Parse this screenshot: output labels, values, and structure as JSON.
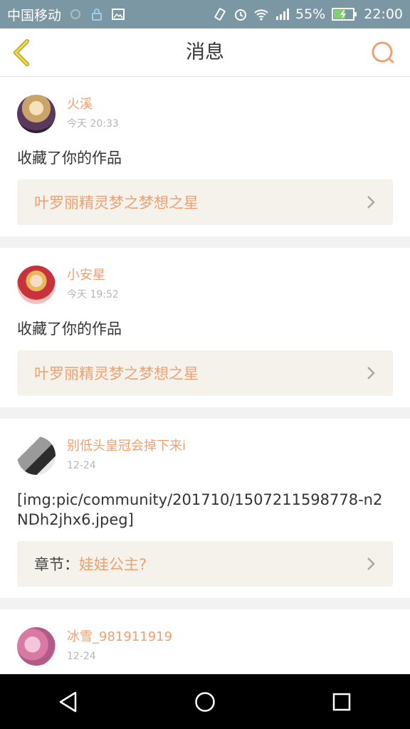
{
  "status": {
    "carrier": "中国移动",
    "battery": "55%",
    "time": "22:00"
  },
  "header": {
    "title": "消息"
  },
  "messages": [
    {
      "username": "火溪",
      "time": "今天 20:33",
      "text": "收藏了你的作品",
      "link": "叶罗丽精灵梦之梦想之星"
    },
    {
      "username": "小安星",
      "time": "今天 19:52",
      "text": "收藏了你的作品",
      "link": "叶罗丽精灵梦之梦想之星"
    },
    {
      "username": "别低头皇冠会掉下来i",
      "time": "12-24",
      "text": "[img:pic/community/201710/1507211598778-n2NDh2jhx6.jpeg]",
      "link_label": "章节：",
      "link": "娃娃公主?"
    },
    {
      "username": "冰雪_981911919",
      "time": "12-24"
    }
  ],
  "colors": {
    "accent": "#f0a070",
    "statusbar": "#7a97a3",
    "link_bg": "#f4f2ea"
  }
}
